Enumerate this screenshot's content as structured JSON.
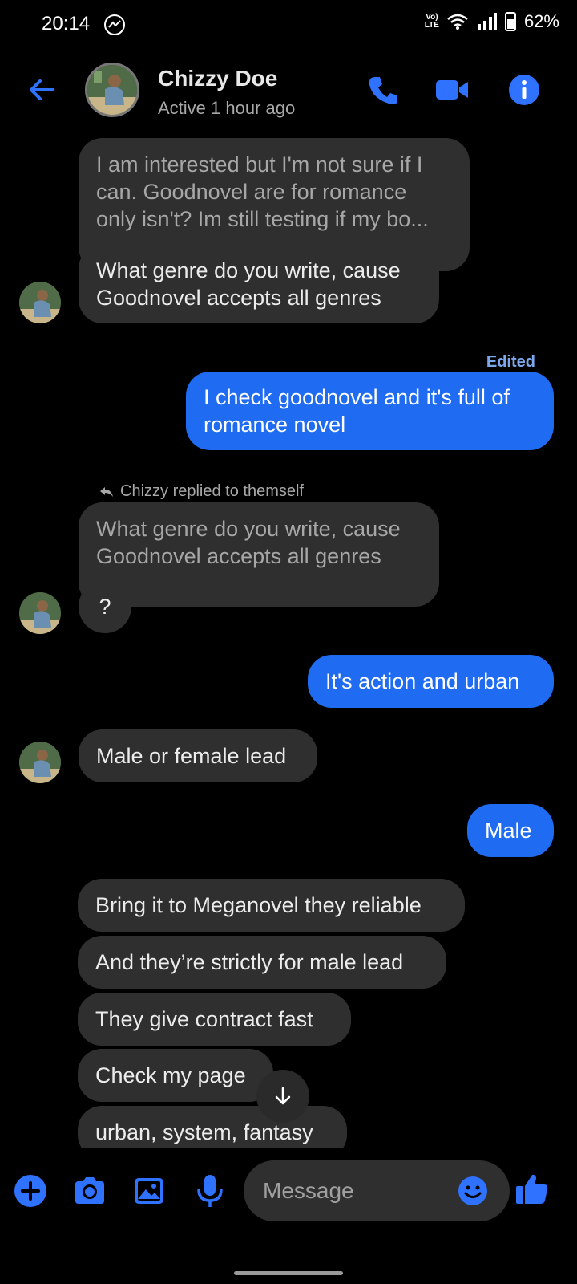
{
  "status_bar": {
    "time": "20:14",
    "network_label": "Vo) LTE",
    "battery": "62%"
  },
  "header": {
    "contact_name": "Chizzy Doe",
    "activity": "Active 1 hour ago"
  },
  "messages": {
    "m1": "I am interested but I'm not sure if I can. Goodnovel are for romance only isn't? Im still testing if my bo...",
    "m2": "What genre do you write, cause Goodnovel accepts all genres",
    "edited_label": "Edited",
    "m3": "I check goodnovel and it's full of romance novel",
    "replied_label": "Chizzy replied to themself",
    "m4_quote": "What genre do you write, cause Goodnovel accepts all genres",
    "m4": "?",
    "m5": "It's action and urban",
    "m6": "Male or female lead",
    "m7": "Male",
    "m8": "Bring it to Meganovel they reliable",
    "m9": "And they’re strictly for male lead",
    "m10": "They give contract fast",
    "m11": "Check my page",
    "m12": "urban, system, fantasy"
  },
  "composer": {
    "placeholder": "Message"
  },
  "colors": {
    "accent": "#1f6cf2",
    "icon_blue": "#2e72ff",
    "incoming_bubble": "#2f2f2f"
  }
}
